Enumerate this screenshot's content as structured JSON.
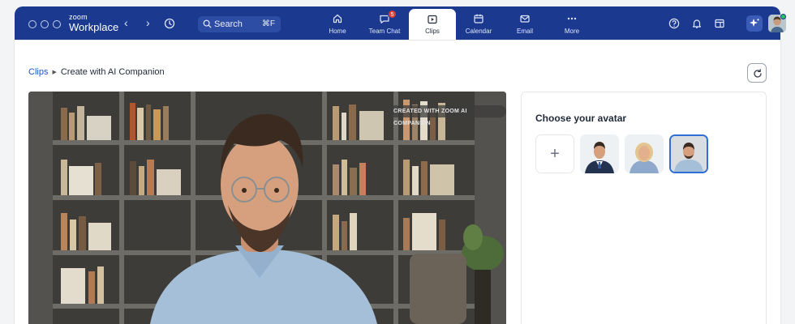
{
  "app": {
    "brand_small": "zoom",
    "brand_big": "Workplace"
  },
  "search": {
    "label": "Search",
    "shortcut": "⌘F"
  },
  "tabs": [
    {
      "label": "Home",
      "icon": "home-icon"
    },
    {
      "label": "Team Chat",
      "icon": "chat-icon",
      "badge": "5"
    },
    {
      "label": "Clips",
      "icon": "clips-icon",
      "active": true
    },
    {
      "label": "Calendar",
      "icon": "calendar-icon"
    },
    {
      "label": "Email",
      "icon": "email-icon"
    },
    {
      "label": "More",
      "icon": "more-icon"
    }
  ],
  "breadcrumb": {
    "root": "Clips",
    "current": "Create with AI Companion"
  },
  "video": {
    "tag": "CREATED WITH ZOOM AI COMPANION"
  },
  "picker": {
    "title": "Choose your avatar",
    "add_symbol": "+",
    "avatars": [
      {
        "name": "man-in-suit",
        "selected": false
      },
      {
        "name": "blonde-woman",
        "selected": false
      },
      {
        "name": "man-with-glasses",
        "selected": true
      }
    ]
  },
  "colors": {
    "topbar": "#1b3a8f",
    "accent": "#2f6fd6",
    "link": "#1a56c9",
    "badge": "#e53935",
    "online": "#22c55e"
  }
}
